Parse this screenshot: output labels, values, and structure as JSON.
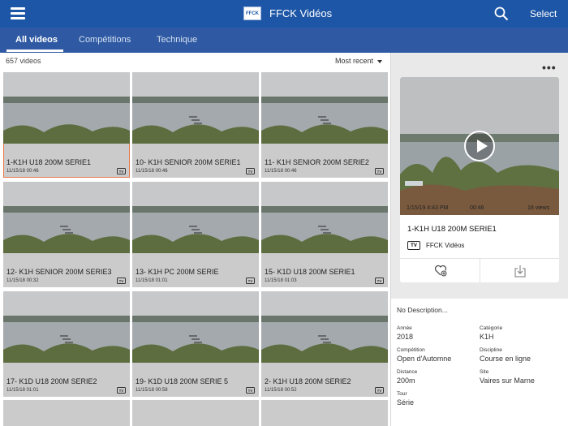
{
  "header": {
    "logo_text": "FFCK",
    "title": "FFCK Vidéos",
    "select_label": "Select"
  },
  "tabs": [
    {
      "label": "All videos",
      "active": true
    },
    {
      "label": "Compétitions",
      "active": false
    },
    {
      "label": "Technique",
      "active": false
    }
  ],
  "list": {
    "count": "657 videos",
    "sort_label": "Most recent",
    "videos": [
      {
        "title": "1-K1H U18 200M SERIE1",
        "date": "11/15/18 00:46",
        "badge": "TV",
        "selected": true
      },
      {
        "title": "10- K1H SENIOR 200M SERIE1",
        "date": "11/15/18 00:46",
        "badge": "TV"
      },
      {
        "title": "11- K1H SENIOR 200M SERIE2",
        "date": "11/15/18 00:46",
        "badge": "TV"
      },
      {
        "title": "12- K1H SENIOR 200M SERIE3",
        "date": "11/15/18 00:32",
        "badge": "TV"
      },
      {
        "title": "13- K1H PC 200M SERIE",
        "date": "11/15/18 01:01",
        "badge": "TV"
      },
      {
        "title": "15- K1D U18 200M SERIE1",
        "date": "11/15/18 01:03",
        "badge": "TV"
      },
      {
        "title": "17- K1D U18 200M SERIE2",
        "date": "11/15/18 01:01",
        "badge": "TV"
      },
      {
        "title": "19- K1D U18 200M SERIE 5",
        "date": "11/15/18 00:58",
        "badge": "TV"
      },
      {
        "title": "2- K1H U18 200M SERIE2",
        "date": "11/15/18 00:52",
        "badge": "TV"
      }
    ]
  },
  "detail": {
    "date": "1/15/19 4:43 PM",
    "duration": "00:46",
    "views": "18 views",
    "title": "1-K1H U18 200M SERIE1",
    "channel_badge": "TV",
    "channel": "FFCK Vidéos",
    "description": "No Description...",
    "fields": [
      {
        "label": "Année",
        "value": "2018"
      },
      {
        "label": "Catégorie",
        "value": "K1H"
      },
      {
        "label": "Compétition",
        "value": "Open d'Automne"
      },
      {
        "label": "Discipline",
        "value": "Course en ligne"
      },
      {
        "label": "Distance",
        "value": "200m"
      },
      {
        "label": "Site",
        "value": "Vaires sur Marne"
      },
      {
        "label": "Tour",
        "value": "Série"
      }
    ]
  },
  "colors": {
    "header": "#1d56a6",
    "tabs": "#2f5aa3",
    "selected_outline": "#e87648"
  }
}
